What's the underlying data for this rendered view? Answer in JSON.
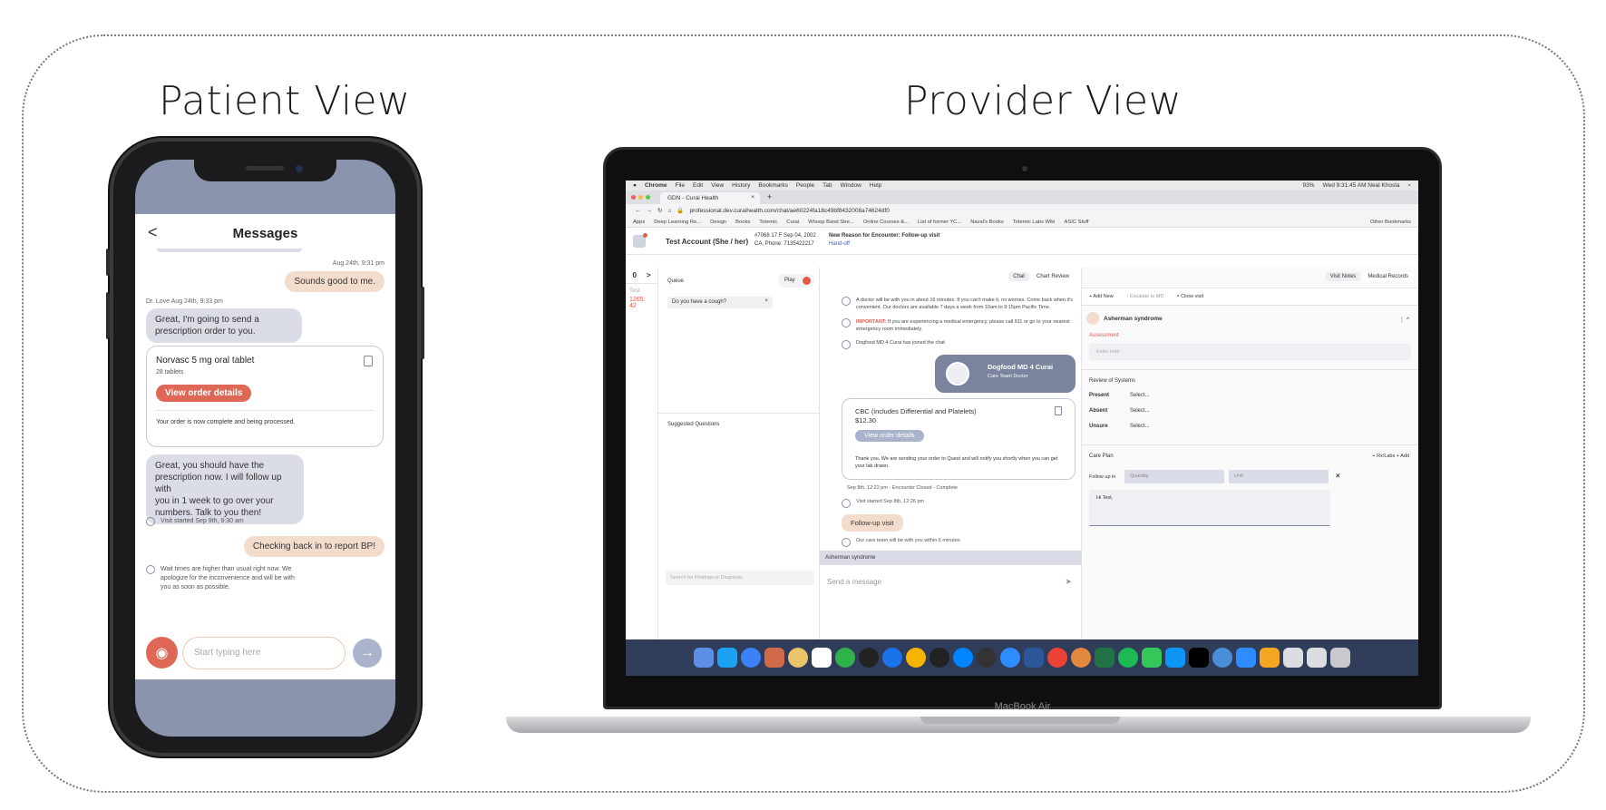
{
  "titles": {
    "patient": "Patient View",
    "provider": "Provider View"
  },
  "patient": {
    "header": {
      "back": "<",
      "title": "Messages"
    },
    "ts1": "Aug 24th, 9:31 pm",
    "msg1": "Sounds good to me.",
    "sender": "Dr. Love  Aug 24th, 9:33 pm",
    "msg2_l1": "Great, I'm going to send a",
    "msg2_l2": "prescription order to you.",
    "order": {
      "name": "Norvasc 5 mg oral tablet",
      "qty": "28 tablets",
      "button": "View order details",
      "status": "Your order is now complete and being processed."
    },
    "msg3": [
      "Great, you should have the",
      "prescription now. I will follow up with",
      "you in 1 week to go over your",
      "numbers. Talk to you then!"
    ],
    "visit_started": "Visit started Sep 9th, 9:30 am",
    "msg4": "Checking back in to report BP!",
    "wait": [
      "Wait times are higher than usual right now. We",
      "apologize for the inconvenience and will be with",
      "you as soon as possible."
    ],
    "composer": {
      "placeholder": "Start typing here"
    }
  },
  "laptop": {
    "brand": "MacBook Air",
    "menubar": [
      "Chrome",
      "File",
      "Edit",
      "View",
      "History",
      "Bookmarks",
      "People",
      "Tab",
      "Window",
      "Help"
    ],
    "clock": "Wed 9:31:45 AM  Neal Khosla",
    "battery": "93%",
    "tab_title": "GDN - Curai Health",
    "tab_close": "×",
    "tab_new": "+",
    "url": "professional.dev.curaihealth.com/chat/ae60224fa18c49bf8432008a74624df0",
    "bookmarks": [
      "Apps",
      "Deep Learning Re...",
      "Design",
      "Books",
      "Totemic",
      "Curai",
      "Whoop Band Stre...",
      "Online Courses &...",
      "List of former YC...",
      "Naval's Books",
      "Totemic Labs Wiki",
      "ASIC Stuff",
      "Other Bookmarks"
    ],
    "patient": {
      "name": "Test Account (She / her)",
      "line1": "#7068 17 F Sep 04, 2002",
      "line2": "CA, Phone: 7135422217",
      "reason_label": "New Reason for Encounter: Follow-up visit",
      "handoff": "Hand-off"
    },
    "left": {
      "count": "0",
      "arrow": ">",
      "name": "Test",
      "code": "1265: 42"
    },
    "queue": {
      "label": "Queue",
      "play": "Play",
      "item": "Do you have a cough?",
      "remove": "×",
      "suggested": "Suggested Questions",
      "search": "Search for Findings or Diagnosis"
    },
    "chat": {
      "tabs": [
        "Chat",
        "Chart Review"
      ],
      "notice1": "A doctor will be with you in about 16 minutes. If you can't make it, no worries. Come back when it's convenient. Our doctors are available 7 days a week from 10am to 9:15pm Pacific Time.",
      "important_label": "IMPORTANT:",
      "important": "If you are experiencing a medical emergency, please call 911 or go to your nearest emergency room immediately.",
      "joined": "Dogfood MD 4 Curai has joined the chat",
      "doctor": "Dogfood MD 4 Curai",
      "doctor_role": "Care Team Doctor",
      "lab": {
        "name": "CBC (includes Differential and Platelets)",
        "price": "$12.30",
        "button": "View order details",
        "note": "Thank you. We are sending your order to Quest and will notify you shortly when you can get your lab drawn."
      },
      "closed": "Sep 8th, 12:22 pm - Encounter Closed - Complete",
      "visit_started": "Visit started Sep 8th, 12:26 pm",
      "followup": "Follow-up visit",
      "careteam": "Our care team will be with you within 6 minutes",
      "dx_bar": "Asherman syndrome",
      "send_placeholder": "Send a message",
      "send_icon": "➤"
    },
    "notes": {
      "tabs": [
        "Visit Notes",
        "Medical Records"
      ],
      "actions": [
        "+ Add New",
        "↑ Escalate to MD",
        "× Close visit"
      ],
      "dx": "Asherman syndrome",
      "dx_menu": "⋮ ^",
      "assessment": "Assessment",
      "enter_note": "Enter note",
      "ros": "Review of Systems",
      "ros_rows": [
        {
          "k": "Present",
          "v": "Select..."
        },
        {
          "k": "Absent",
          "v": "Select..."
        },
        {
          "k": "Unsure",
          "v": "Select..."
        }
      ],
      "careplan": "Care Plan",
      "careplan_actions": "+ Rx/Labs   + Add",
      "followup_label": "Follow up in",
      "quantity": "Quantity",
      "unit": "Unit",
      "remove": "×",
      "hi": "Hi Test,"
    }
  }
}
